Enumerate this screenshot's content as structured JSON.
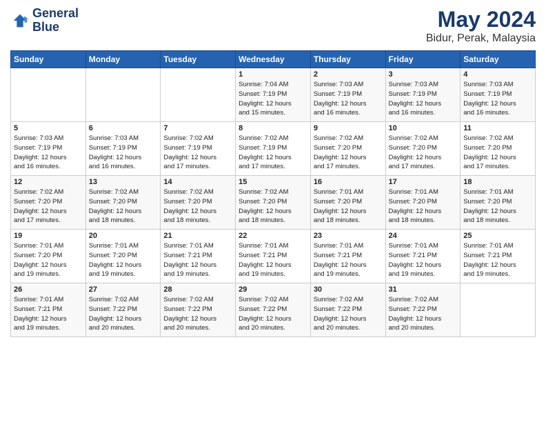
{
  "logo": {
    "line1": "General",
    "line2": "Blue"
  },
  "title": "May 2024",
  "location": "Bidur, Perak, Malaysia",
  "days_header": [
    "Sunday",
    "Monday",
    "Tuesday",
    "Wednesday",
    "Thursday",
    "Friday",
    "Saturday"
  ],
  "weeks": [
    [
      {
        "day": "",
        "info": ""
      },
      {
        "day": "",
        "info": ""
      },
      {
        "day": "",
        "info": ""
      },
      {
        "day": "1",
        "info": "Sunrise: 7:04 AM\nSunset: 7:19 PM\nDaylight: 12 hours\nand 15 minutes."
      },
      {
        "day": "2",
        "info": "Sunrise: 7:03 AM\nSunset: 7:19 PM\nDaylight: 12 hours\nand 16 minutes."
      },
      {
        "day": "3",
        "info": "Sunrise: 7:03 AM\nSunset: 7:19 PM\nDaylight: 12 hours\nand 16 minutes."
      },
      {
        "day": "4",
        "info": "Sunrise: 7:03 AM\nSunset: 7:19 PM\nDaylight: 12 hours\nand 16 minutes."
      }
    ],
    [
      {
        "day": "5",
        "info": "Sunrise: 7:03 AM\nSunset: 7:19 PM\nDaylight: 12 hours\nand 16 minutes."
      },
      {
        "day": "6",
        "info": "Sunrise: 7:03 AM\nSunset: 7:19 PM\nDaylight: 12 hours\nand 16 minutes."
      },
      {
        "day": "7",
        "info": "Sunrise: 7:02 AM\nSunset: 7:19 PM\nDaylight: 12 hours\nand 17 minutes."
      },
      {
        "day": "8",
        "info": "Sunrise: 7:02 AM\nSunset: 7:19 PM\nDaylight: 12 hours\nand 17 minutes."
      },
      {
        "day": "9",
        "info": "Sunrise: 7:02 AM\nSunset: 7:20 PM\nDaylight: 12 hours\nand 17 minutes."
      },
      {
        "day": "10",
        "info": "Sunrise: 7:02 AM\nSunset: 7:20 PM\nDaylight: 12 hours\nand 17 minutes."
      },
      {
        "day": "11",
        "info": "Sunrise: 7:02 AM\nSunset: 7:20 PM\nDaylight: 12 hours\nand 17 minutes."
      }
    ],
    [
      {
        "day": "12",
        "info": "Sunrise: 7:02 AM\nSunset: 7:20 PM\nDaylight: 12 hours\nand 17 minutes."
      },
      {
        "day": "13",
        "info": "Sunrise: 7:02 AM\nSunset: 7:20 PM\nDaylight: 12 hours\nand 18 minutes."
      },
      {
        "day": "14",
        "info": "Sunrise: 7:02 AM\nSunset: 7:20 PM\nDaylight: 12 hours\nand 18 minutes."
      },
      {
        "day": "15",
        "info": "Sunrise: 7:02 AM\nSunset: 7:20 PM\nDaylight: 12 hours\nand 18 minutes."
      },
      {
        "day": "16",
        "info": "Sunrise: 7:01 AM\nSunset: 7:20 PM\nDaylight: 12 hours\nand 18 minutes."
      },
      {
        "day": "17",
        "info": "Sunrise: 7:01 AM\nSunset: 7:20 PM\nDaylight: 12 hours\nand 18 minutes."
      },
      {
        "day": "18",
        "info": "Sunrise: 7:01 AM\nSunset: 7:20 PM\nDaylight: 12 hours\nand 18 minutes."
      }
    ],
    [
      {
        "day": "19",
        "info": "Sunrise: 7:01 AM\nSunset: 7:20 PM\nDaylight: 12 hours\nand 19 minutes."
      },
      {
        "day": "20",
        "info": "Sunrise: 7:01 AM\nSunset: 7:20 PM\nDaylight: 12 hours\nand 19 minutes."
      },
      {
        "day": "21",
        "info": "Sunrise: 7:01 AM\nSunset: 7:21 PM\nDaylight: 12 hours\nand 19 minutes."
      },
      {
        "day": "22",
        "info": "Sunrise: 7:01 AM\nSunset: 7:21 PM\nDaylight: 12 hours\nand 19 minutes."
      },
      {
        "day": "23",
        "info": "Sunrise: 7:01 AM\nSunset: 7:21 PM\nDaylight: 12 hours\nand 19 minutes."
      },
      {
        "day": "24",
        "info": "Sunrise: 7:01 AM\nSunset: 7:21 PM\nDaylight: 12 hours\nand 19 minutes."
      },
      {
        "day": "25",
        "info": "Sunrise: 7:01 AM\nSunset: 7:21 PM\nDaylight: 12 hours\nand 19 minutes."
      }
    ],
    [
      {
        "day": "26",
        "info": "Sunrise: 7:01 AM\nSunset: 7:21 PM\nDaylight: 12 hours\nand 19 minutes."
      },
      {
        "day": "27",
        "info": "Sunrise: 7:02 AM\nSunset: 7:22 PM\nDaylight: 12 hours\nand 20 minutes."
      },
      {
        "day": "28",
        "info": "Sunrise: 7:02 AM\nSunset: 7:22 PM\nDaylight: 12 hours\nand 20 minutes."
      },
      {
        "day": "29",
        "info": "Sunrise: 7:02 AM\nSunset: 7:22 PM\nDaylight: 12 hours\nand 20 minutes."
      },
      {
        "day": "30",
        "info": "Sunrise: 7:02 AM\nSunset: 7:22 PM\nDaylight: 12 hours\nand 20 minutes."
      },
      {
        "day": "31",
        "info": "Sunrise: 7:02 AM\nSunset: 7:22 PM\nDaylight: 12 hours\nand 20 minutes."
      },
      {
        "day": "",
        "info": ""
      }
    ]
  ]
}
